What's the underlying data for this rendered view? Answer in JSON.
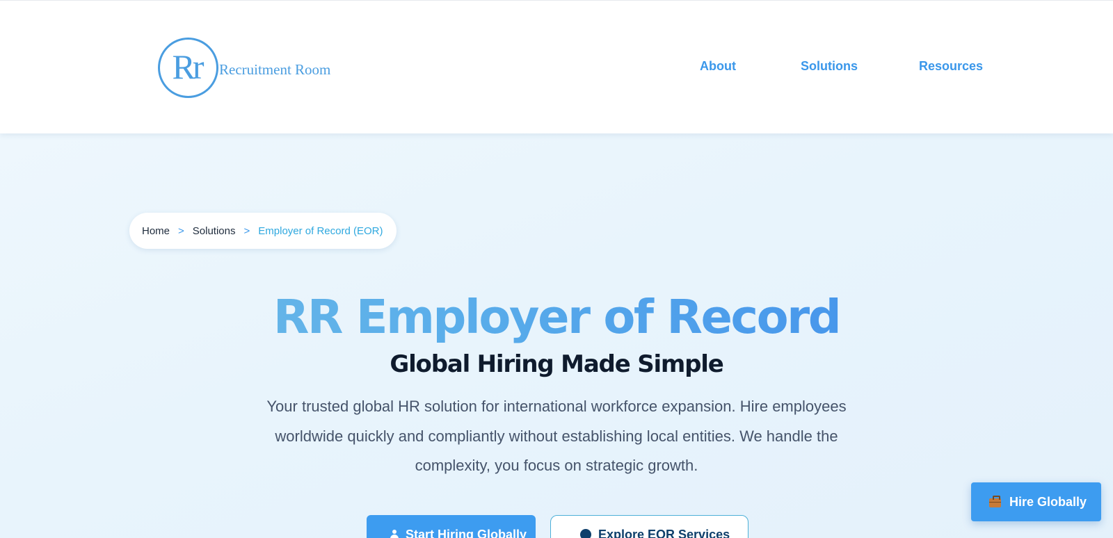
{
  "header": {
    "logo": {
      "mark": "Rr",
      "text": "Recruitment Room"
    },
    "nav": [
      {
        "label": "About"
      },
      {
        "label": "Solutions"
      },
      {
        "label": "Resources"
      }
    ]
  },
  "breadcrumb": {
    "items": [
      "Home",
      "Solutions"
    ],
    "separator": ">",
    "current": "Employer of Record (EOR)"
  },
  "hero": {
    "title": "RR Employer of Record",
    "subtitle": "Global Hiring Made Simple",
    "description": "Your trusted global HR solution for international workforce expansion. Hire employees worldwide quickly and compliantly without establishing local entities. We handle the complexity, you focus on strategic growth.",
    "primary_button": {
      "label": "Start Hiring Globally",
      "icon": "person-icon"
    },
    "secondary_button": {
      "label": "Explore EOR Services",
      "icon": "info-icon"
    }
  },
  "floating_cta": {
    "label": "Hire Globally",
    "icon": "briefcase-icon"
  },
  "colors": {
    "accent": "#3d9cf0",
    "nav_text": "#3a97ea",
    "heading_dark": "#0f1b2d",
    "body_text": "#45536a"
  }
}
